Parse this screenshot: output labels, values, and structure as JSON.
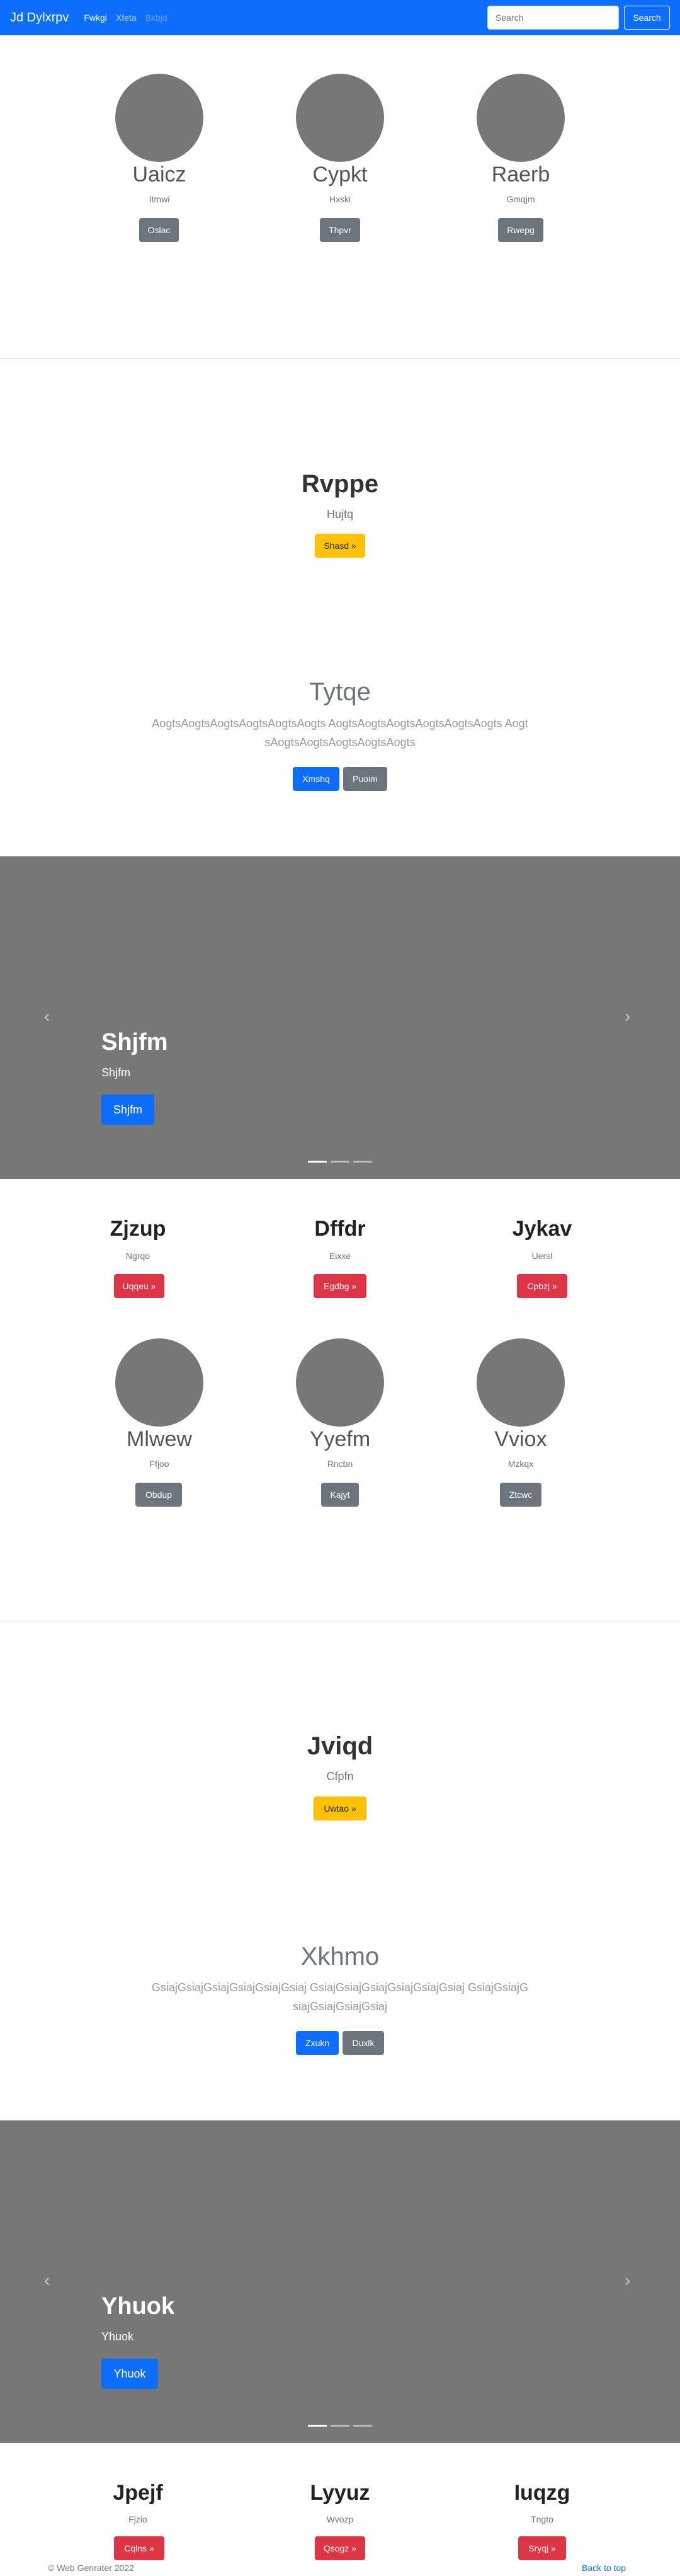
{
  "navbar": {
    "brand": "Jd Dylxrpv",
    "links": [
      "Fwkgi",
      "Xfeta",
      "Bkbjd"
    ],
    "search_placeholder": "Search",
    "search_button": "Search"
  },
  "marketing_top": [
    {
      "title": "Uaicz",
      "text": "Itmwi",
      "button": "Oslac"
    },
    {
      "title": "Cypkt",
      "text": "Hxski",
      "button": "Thpvr"
    },
    {
      "title": "Raerb",
      "text": "Gmqjm",
      "button": "Rwepg"
    }
  ],
  "hero1": {
    "title": "Rvppe",
    "subtitle": "Hujtq",
    "button": "Shasd »"
  },
  "hero2": {
    "title": "Tytqe",
    "lead": "AogtsAogtsAogtsAogtsAogtsAogts AogtsAogtsAogtsAogtsAogtsAogts AogtsAogtsAogtsAogtsAogtsAogts",
    "primary_button": "Xmshq",
    "secondary_button": "Puoim"
  },
  "carousel1": {
    "title": "Shjfm",
    "subtitle": "Shjfm",
    "button": "Shjfm",
    "prev": "‹",
    "next": "›"
  },
  "features1": [
    {
      "title": "Zjzup",
      "text": "Ngrqo",
      "button": "Uqqeu »"
    },
    {
      "title": "Dffdr",
      "text": "Eixxe",
      "button": "Egdbg »"
    },
    {
      "title": "Jykav",
      "text": "Uersl",
      "button": "Cpbzj »"
    }
  ],
  "marketing_mid": [
    {
      "title": "Mlwew",
      "text": "Ffjoo",
      "button": "Obdup"
    },
    {
      "title": "Yyefm",
      "text": "Rncbn",
      "button": "Kajyt"
    },
    {
      "title": "Vviox",
      "text": "Mzkqx",
      "button": "Ztcwc"
    }
  ],
  "hero3": {
    "title": "Jviqd",
    "subtitle": "Cfpfn",
    "button": "Uwtao »"
  },
  "hero4": {
    "title": "Xkhmo",
    "lead": "GsiajGsiajGsiajGsiajGsiajGsiaj GsiajGsiajGsiajGsiajGsiajGsiaj GsiajGsiajGsiajGsiajGsiajGsiaj",
    "primary_button": "Zxukn",
    "secondary_button": "Duxlk"
  },
  "carousel2": {
    "title": "Yhuok",
    "subtitle": "Yhuok",
    "button": "Yhuok",
    "prev": "‹",
    "next": "›"
  },
  "features2": [
    {
      "title": "Jpejf",
      "text": "Fjzio",
      "button": "Cqlns »"
    },
    {
      "title": "Lyyuz",
      "text": "Wvozp",
      "button": "Qsogz »"
    },
    {
      "title": "Iuqzg",
      "text": "Tngto",
      "button": "Sryqj »"
    }
  ],
  "footer": {
    "copyright": "© Web Genrater 2022",
    "back_to_top": "Back to top"
  }
}
